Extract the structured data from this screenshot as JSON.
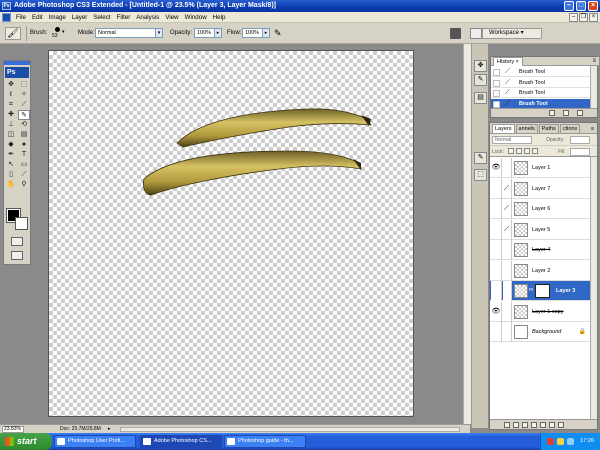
{
  "window": {
    "title": "Adobe Photoshop CS3 Extended - [Untitled-1 @ 23.5% (Layer 3, Layer Mask/8)]",
    "app_icon_label": "Ps"
  },
  "menu": [
    "File",
    "Edit",
    "Image",
    "Layer",
    "Select",
    "Filter",
    "Analysis",
    "View",
    "Window",
    "Help"
  ],
  "options": {
    "brush_label": "Brush:",
    "brush_size": "53",
    "mode_label": "Mode:",
    "mode_value": "Normal",
    "opacity_label": "Opacity:",
    "opacity_value": "100%",
    "flow_label": "Flow:",
    "flow_value": "100%",
    "workspace_label": "Workspace"
  },
  "toolbox": {
    "badge": "Ps"
  },
  "status": {
    "zoom": "23.83%",
    "doc": "Doc: 25.7M/29.8M",
    "arrow": "▸"
  },
  "history": {
    "tab": "History",
    "menu_glyph": "≡",
    "items": [
      {
        "label": "Brush Tool",
        "selected": false
      },
      {
        "label": "Brush Tool",
        "selected": false
      },
      {
        "label": "Brush Tool",
        "selected": false
      },
      {
        "label": "Brush Tool",
        "selected": true
      }
    ]
  },
  "layers_panel": {
    "tabs": [
      "Layers",
      "annels",
      "Paths",
      "ctions"
    ],
    "menu_glyph": "≡",
    "blend_mode": "Normal",
    "opacity_label": "Opacity:",
    "lock_label": "Lock:",
    "fill_label": "Fill:",
    "layers": [
      {
        "name": "Layer 1",
        "visible": true,
        "selected": false,
        "strike": false,
        "italic": false,
        "mask": false,
        "brush": false,
        "thumb": "checker"
      },
      {
        "name": "Layer 7",
        "visible": false,
        "selected": false,
        "strike": false,
        "italic": false,
        "mask": false,
        "brush": true,
        "thumb": "checker"
      },
      {
        "name": "Layer 6",
        "visible": false,
        "selected": false,
        "strike": false,
        "italic": false,
        "mask": false,
        "brush": true,
        "thumb": "checker"
      },
      {
        "name": "Layer 5",
        "visible": false,
        "selected": false,
        "strike": false,
        "italic": false,
        "mask": false,
        "brush": true,
        "thumb": "checker"
      },
      {
        "name": "Layer 4",
        "visible": false,
        "selected": false,
        "strike": true,
        "italic": false,
        "mask": false,
        "brush": false,
        "thumb": "checker"
      },
      {
        "name": "Layer 2",
        "visible": false,
        "selected": false,
        "strike": false,
        "italic": false,
        "mask": false,
        "brush": false,
        "thumb": "checker"
      },
      {
        "name": "Layer 3",
        "visible": false,
        "selected": true,
        "strike": false,
        "italic": false,
        "mask": true,
        "brush": true,
        "thumb": "checker"
      },
      {
        "name": "Layer 1 copy",
        "visible": true,
        "selected": false,
        "strike": true,
        "italic": false,
        "mask": false,
        "brush": false,
        "thumb": "checker"
      },
      {
        "name": "Background",
        "visible": false,
        "selected": false,
        "strike": false,
        "italic": true,
        "mask": false,
        "brush": false,
        "thumb": "white"
      }
    ]
  },
  "taskbar": {
    "start": "start",
    "buttons": [
      {
        "label": "Photoshop User Profi...",
        "active": false
      },
      {
        "label": "Adobe Photoshop CS...",
        "active": true
      },
      {
        "label": "Photoshop guide - th...",
        "active": false
      }
    ],
    "clock": "17:26"
  },
  "colors": {
    "accent": "#3168c6",
    "titlebar": "#0a3cb0",
    "taskbar": "#245edb",
    "banana": "#c9b24a"
  }
}
